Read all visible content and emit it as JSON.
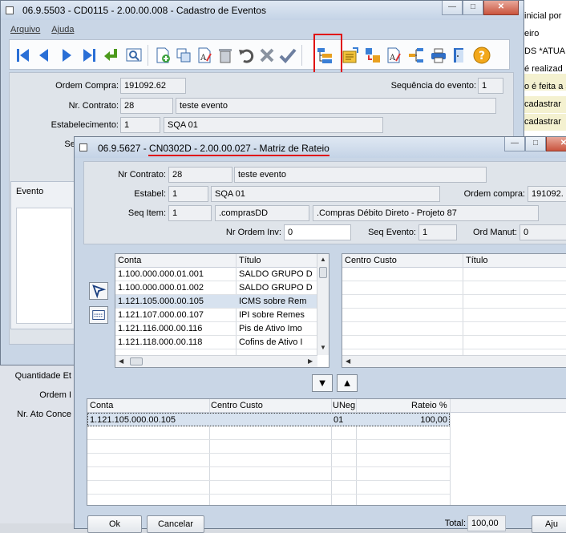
{
  "bg_document": {
    "lines": [
      "inicial por",
      "eiro",
      "DS *ATUAL",
      "é realizad",
      "o é feita a s",
      "cadastrar",
      "cadastrar"
    ]
  },
  "bg_lower": {
    "labels": [
      "Quantidade Et",
      "Ordem I",
      "Nr. Ato Conce"
    ]
  },
  "window1": {
    "title": "06.9.5503 - CD0115 - 2.00.00.008 - Cadastro de Eventos",
    "menu": [
      "Arquivo",
      "Ajuda"
    ],
    "toolbar_icons": [
      "first-icon",
      "previous-icon",
      "next-icon",
      "last-icon",
      "goto-icon",
      "search-icon",
      "add-icon",
      "copy-icon",
      "edit-icon",
      "delete-icon",
      "undo-icon",
      "cancel-icon",
      "save-icon",
      "rateio-icon",
      "query-icon",
      "special-icon",
      "edit2-icon",
      "tree-icon",
      "print-icon",
      "exit-icon",
      "help-icon"
    ],
    "form": {
      "ordem_compra_label": "Ordem Compra:",
      "ordem_compra_value": "191092.62",
      "sequencia_label": "Sequência do evento:",
      "sequencia_value": "1",
      "contrato_label": "Nr. Contrato:",
      "contrato_value": "28",
      "contrato_desc": "teste evento",
      "estab_label": "Estabelecimento:",
      "estab_value": "1",
      "estab_desc": "SQA 01",
      "seq_label": "Seq",
      "evento_tab": "Evento"
    }
  },
  "window2": {
    "title": "06.9.5627 - CN0302D - 2.00.00.027 - Matriz de Rateio",
    "form": {
      "contrato_label": "Nr Contrato:",
      "contrato_value": "28",
      "contrato_desc": "teste evento",
      "estabel_label": "Estabel:",
      "estabel_value": "1",
      "estabel_desc": "SQA 01",
      "ordem_label": "Ordem compra:",
      "ordem_value": "191092.",
      "seqitem_label": "Seq Item:",
      "seqitem_value": "1",
      "seqitem_code": ".comprasDD",
      "seqitem_desc": ".Compras Débito Direto - Projeto 87",
      "ordeminv_label": "Nr Ordem Inv:",
      "ordeminv_value": "0",
      "seqevento_label": "Seq Evento:",
      "seqevento_value": "1",
      "ordmanut_label": "Ord Manut:",
      "ordmanut_value": "0"
    },
    "contas_grid": {
      "headers": [
        "Conta",
        "Título"
      ],
      "rows": [
        [
          "1.100.000.000.01.001",
          "SALDO GRUPO D"
        ],
        [
          "1.100.000.000.01.002",
          "SALDO GRUPO D"
        ],
        [
          "1.121.105.000.00.105",
          "ICMS sobre Rem"
        ],
        [
          "1.121.107.000.00.107",
          "IPI sobre Remes"
        ],
        [
          "1.121.116.000.00.116",
          "Pis de Ativo Imo"
        ],
        [
          "1.121.118.000.00.118",
          "Cofins de Ativo I"
        ]
      ]
    },
    "cc_grid": {
      "headers": [
        "Centro Custo",
        "Título"
      ]
    },
    "rateio_grid": {
      "headers": [
        "Conta",
        "Centro Custo",
        "UNeg",
        "Rateio %"
      ],
      "rows": [
        [
          "1.121.105.000.00.105",
          "",
          "01",
          "100,00"
        ]
      ]
    },
    "buttons": {
      "ok": "Ok",
      "cancel": "Cancelar",
      "help": "Aju"
    },
    "total_label": "Total:",
    "total_value": "100,00"
  }
}
